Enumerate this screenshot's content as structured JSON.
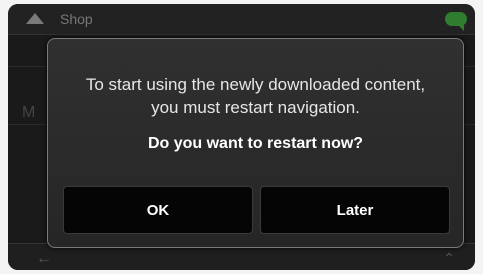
{
  "topbar": {
    "title": "Shop",
    "up_icon": "chevron-up-icon",
    "chat_icon": "chat-bubble-icon"
  },
  "background": {
    "letter_1": "",
    "letter_2": "M"
  },
  "dialog": {
    "message_line_1": "To start using the newly downloaded content,",
    "message_line_2": "you must restart navigation.",
    "question": "Do you want to restart now?",
    "ok_label": "OK",
    "later_label": "Later"
  },
  "colors": {
    "dialog_background": "#2b2b2b",
    "button_background": "#050505",
    "chat_accent": "#2f7d2f"
  }
}
